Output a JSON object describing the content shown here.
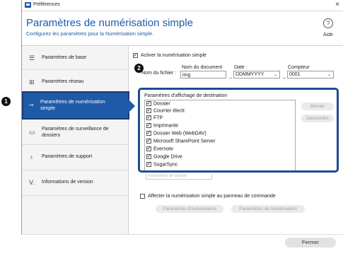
{
  "window": {
    "title": "Préférences",
    "close": "×"
  },
  "header": {
    "title": "Paramètres de numérisation simple",
    "subtitle": "Configurez les paramètres pour la Numérisation simple.",
    "help_icon": "?",
    "help_label": "Aide"
  },
  "sidebar": {
    "items": [
      {
        "icon": "list-icon",
        "glyph": "☰",
        "label": "Paramètres de base"
      },
      {
        "icon": "network-icon",
        "glyph": "⊞",
        "label": "Paramètres réseau"
      },
      {
        "icon": "key-icon",
        "glyph": "⊸",
        "label": "Paramètres de numérisation simple",
        "selected": true
      },
      {
        "icon": "folder-icon",
        "glyph": "▭",
        "label": "Paramètres de surveillance de dossiers"
      },
      {
        "icon": "support-icon",
        "glyph": "♁",
        "label": "Paramètres de support"
      },
      {
        "icon": "version-icon",
        "glyph": "V.",
        "label": "Informations de version"
      }
    ]
  },
  "callouts": {
    "one": "1",
    "two": "2"
  },
  "main": {
    "enable_label": "Activer la numérisation simple",
    "filename_label": "Nom du fichier :",
    "doc_name_label": "Nom du document",
    "doc_name_value": "img",
    "date_label": "Date :",
    "date_value": "DDMMYYYY",
    "counter_label": "Compteur",
    "counter_value": "0001",
    "separator": "_",
    "dest_label": "Paramètres d'affichage de destination",
    "destinations": [
      "Dossier",
      "Courrier électr.",
      "FTP",
      "Imprimante",
      "Dossier Web (WebDAV)",
      "Microsoft SharePoint Server",
      "Evernote",
      "Google Drive",
      "SugarSync"
    ],
    "up_button": "Monter",
    "down_button": "Descendre",
    "hidden_text": "Paramètres de dossier",
    "assign_label": "Affecter la numérisation simple au panneau de commande",
    "events_button": "Paramètres d'événements",
    "scan_settings_button": "Paramètres de numérisation",
    "close_button": "Fermer"
  },
  "colors": {
    "accent": "#1e5aa8",
    "highlight_border": "#1e4c8e"
  }
}
